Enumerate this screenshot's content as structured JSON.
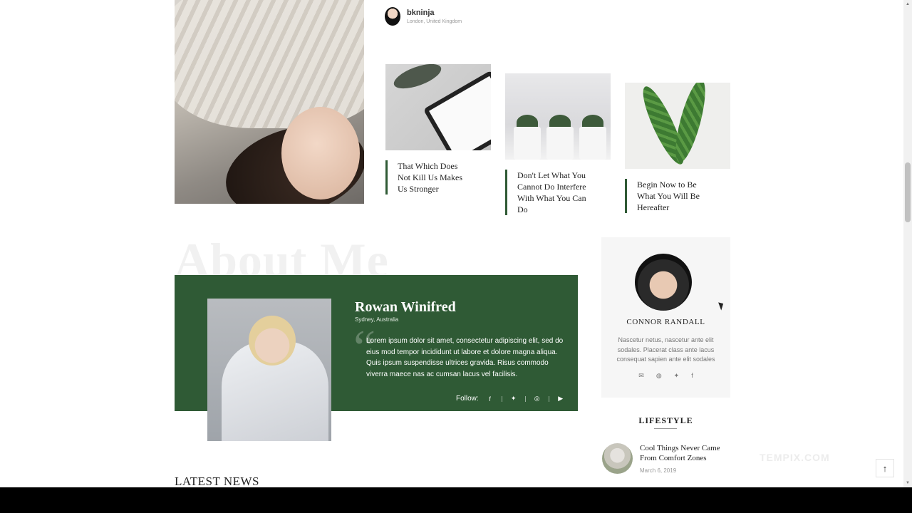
{
  "author": {
    "name": "bkninja",
    "location": "London, United Kingdom"
  },
  "cards": [
    {
      "title": "That Which Does Not Kill Us Makes Us Stronger"
    },
    {
      "title": "Don't Let What You Cannot Do Interfere With What You Can Do"
    },
    {
      "title": "Begin Now to Be What You Will Be Hereafter"
    }
  ],
  "about": {
    "heading": "About Me",
    "name": "Rowan Winifred",
    "location": "Sydney, Australia",
    "quote_mark": "“",
    "text": "Lorem ipsum dolor sit amet, consectetur adipiscing elit, sed do eius mod tempor incididunt ut labore et dolore magna aliqua. Quis ipsum suspendisse ultrices gravida. Risus commodo viverra maece nas ac cumsan lacus vel facilisis.",
    "follow_label": "Follow:",
    "social_icons": [
      "facebook-icon",
      "twitter-icon",
      "instagram-icon",
      "youtube-icon"
    ]
  },
  "latest_news": "LATEST NEWS",
  "profile": {
    "name": "CONNOR RANDALL",
    "bio": "Nascetur netus, nascetur ante elit sodales. Placerat class ante lacus consequat sapien ante elit sodales",
    "social_icons": [
      "mail-icon",
      "globe-icon",
      "twitter-icon",
      "facebook-icon"
    ]
  },
  "lifestyle": {
    "heading": "LIFESTYLE",
    "post": {
      "title": "Cool Things Never Came From Comfort Zones",
      "date": "March 6, 2019"
    }
  },
  "watermark": "TEMPIX.COM",
  "to_top": "↑",
  "colors": {
    "accent_green": "#2f5a35"
  }
}
